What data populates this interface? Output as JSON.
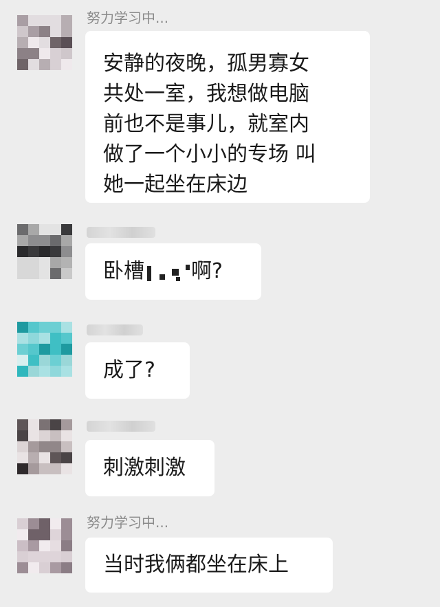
{
  "messages": [
    {
      "sender": "努力学习中...",
      "lines": [
        "安静的夜晚，孤男寡女",
        "共处一室，我想做电脑",
        "前也不是事儿，就室内",
        "做了一个小小的专场  叫",
        "她一起坐在床边"
      ]
    },
    {
      "sender": "",
      "text_before": "卧槽",
      "text_after": "啊?"
    },
    {
      "sender": "",
      "text": "成了?"
    },
    {
      "sender": "",
      "text": "刺激刺激"
    },
    {
      "sender": "努力学习中...",
      "text": "当时我俩都坐在床上"
    }
  ],
  "colors": {
    "background": "#ededed",
    "bubble": "#ffffff",
    "sender_name": "#8a8a8a",
    "text": "#1a1a1a"
  },
  "icons": {
    "avatar": "avatar-pixelated"
  }
}
